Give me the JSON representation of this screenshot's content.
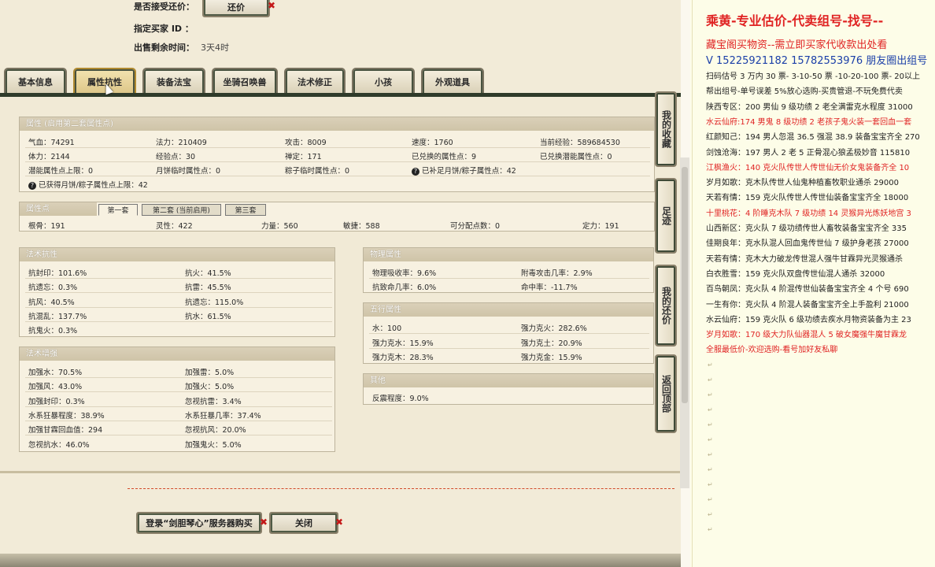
{
  "form": {
    "accept_counter_label": "是否接受还价：",
    "counter_button": "还价",
    "buyer_id_label": "指定买家 ID ：",
    "time_left_label": "出售剩余时间：",
    "time_left_value": "3天4时"
  },
  "tabs": [
    "基本信息",
    "属性抗性",
    "装备法宝",
    "坐骑召唤兽",
    "法术修正",
    "小孩",
    "外观道具"
  ],
  "attributes": {
    "title": "属性 (启用第二套属性点)",
    "rows": [
      [
        "气血：74291",
        "法力：210409",
        "攻击：8009",
        "速度：1760",
        "当前经验：589684530"
      ],
      [
        "体力：2144",
        "经验点：30",
        "禅定：171",
        "已兑换的属性点：9",
        "已兑换潜能属性点：0"
      ],
      [
        "潜能属性点上限：0",
        "月饼临时属性点：0",
        "粽子临时属性点：0",
        "已补足月饼/粽子属性点：42",
        ""
      ]
    ],
    "footnote": "已获得月饼/粽子属性点上限：42"
  },
  "points": {
    "title": "属性点",
    "subtabs": [
      "第一套",
      "第二套 (当前启用)",
      "第三套"
    ],
    "values": [
      "根骨：191",
      "灵性：422",
      "力量：560",
      "敏捷：588",
      "可分配点数：0",
      "定力：191"
    ]
  },
  "magic_resist": {
    "title": "法术抗性",
    "rows": [
      [
        "抗封印：101.6%",
        "抗火：41.5%"
      ],
      [
        "抗遗忘：0.3%",
        "抗雷：45.5%"
      ],
      [
        "抗风：40.5%",
        "抗遗忘：115.0%"
      ],
      [
        "抗混乱：137.7%",
        "抗水：61.5%"
      ],
      [
        "抗鬼火：0.3%",
        ""
      ]
    ]
  },
  "physical": {
    "title": "物理属性",
    "rows": [
      [
        "物理吸收率：9.6%",
        "附毒攻击几率：2.9%"
      ],
      [
        "抗致命几率：6.0%",
        "命中率：-11.7%"
      ]
    ]
  },
  "five_elements": {
    "title": "五行属性",
    "rows": [
      [
        "水：100",
        "强力克火：282.6%"
      ],
      [
        "强力克水：15.9%",
        "强力克土：20.9%"
      ],
      [
        "强力克木：28.3%",
        "强力克金：15.9%"
      ]
    ]
  },
  "other": {
    "title": "其他",
    "rows": [
      [
        "反震程度：9.0%"
      ]
    ]
  },
  "magic_boost": {
    "title": "法术增强",
    "rows": [
      [
        "加强水：70.5%",
        "加强雷：5.0%"
      ],
      [
        "加强风：43.0%",
        "加强火：5.0%"
      ],
      [
        "加强封印：0.3%",
        "忽视抗雷：3.4%"
      ],
      [
        "水系狂暴程度：38.9%",
        "水系狂暴几率：37.4%"
      ],
      [
        "加强甘霖回血值：294",
        "忽视抗风：20.0%"
      ],
      [
        "忽视抗水：46.0%",
        "加强鬼火：5.0%"
      ]
    ]
  },
  "side_buttons": [
    "我的收藏",
    "足迹",
    "我的还价",
    "返回顶部"
  ],
  "bottom": {
    "login_button": "登录“剑胆琴心”服务器购买",
    "close_button": "关闭"
  },
  "notepad": {
    "title": "乘黄-专业估价-代卖组号-找号--",
    "lines": [
      {
        "text": "藏宝阁买物资--需立即买家代收款出处看",
        "color": "red"
      },
      {
        "text": "V 15225921182    15782553976 朋友圈出组号",
        "color": "blue"
      },
      {
        "text": "扫码估号 3 万内 30 票- 3-10-50 票  -10-20-100 票- 20以上",
        "color": "black"
      },
      {
        "text": "帮出组号-单号误差 5%放心选购-买贵管退-不玩免费代卖",
        "color": "black"
      },
      {
        "text": "陕西专区：200 男仙 9 级功绩 2 老全满雷克水程度 31000",
        "color": "black"
      },
      {
        "text": "水云仙府:174 男鬼 8 级功绩 2 老孩子鬼火装一套回血一套",
        "color": "red"
      },
      {
        "text": "红颜知己：194 男人忽混 36.5 强混 38.9 装备宝宝齐全 270",
        "color": "black"
      },
      {
        "text": "剑蚀沧海：197 男人 2 老 5 正骨混心狼孟极妙音 115810",
        "color": "black"
      },
      {
        "text": "江枫渔火：140 克火队传世人传世仙无价女鬼装备齐全 10",
        "color": "red"
      },
      {
        "text": "岁月如歌：克木队传世人仙鬼种植畜牧职业通杀 29000",
        "color": "black"
      },
      {
        "text": "天若有情：159 克火队传世人传世仙装备宝宝齐全 18000",
        "color": "black"
      },
      {
        "text": "十里桃花：4 阶睡克木队 7 级功绩 14 灵猴异光炼妖地宫 3",
        "color": "red"
      },
      {
        "text": "山西新区：克火队 7 级功绩传世人畜牧装备宝宝齐全 335",
        "color": "black"
      },
      {
        "text": "佳期良年：克水队混人回血鬼传世仙 7 级护身老孩 27000",
        "color": "black"
      },
      {
        "text": "天若有情：克木大力破龙传世混人强牛甘霖异光灵猴通杀",
        "color": "black"
      },
      {
        "text": "白衣胜雪：159 克火队双盘传世仙混人通杀 32000",
        "color": "black"
      },
      {
        "text": "百鸟朝凤：克火队 4 阶混传世仙装备宝宝齐全 4 个号 690",
        "color": "black"
      },
      {
        "text": "一生有你：克火队 4 阶混人装备宝宝齐全上手盈利 21000",
        "color": "black"
      },
      {
        "text": "水云仙府：159 克火队 6 级功绩去疾水月物资装备为主 23",
        "color": "black"
      },
      {
        "text": "岁月如歌：170 级大力队仙器混人 5 破女魔强牛魔甘霖龙",
        "color": "red"
      },
      {
        "text": "全服最低价-欢迎选购-看号加好友私聊",
        "color": "red"
      }
    ]
  },
  "colors": {
    "accent_red": "#e02323",
    "tab_active": "#dcc587",
    "panel_bg": "#f1ead6"
  },
  "icons": [
    "close-x-icon",
    "question-icon",
    "cursor-icon"
  ]
}
